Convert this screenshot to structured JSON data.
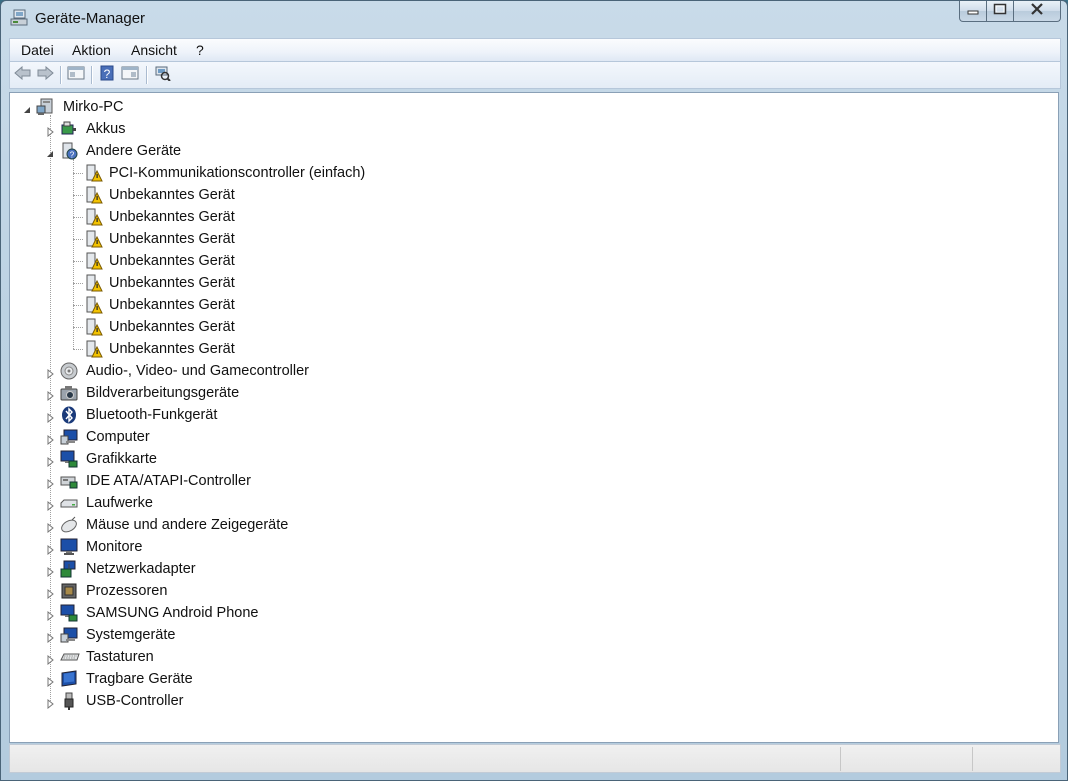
{
  "window": {
    "title": "Geräte-Manager"
  },
  "menu": {
    "items": [
      "Datei",
      "Aktion",
      "Ansicht",
      "?"
    ]
  },
  "toolbar": {
    "buttons": [
      "back-arrow-icon",
      "forward-arrow-icon",
      "properties-pane-icon",
      "help-icon",
      "view-icon",
      "scan-hardware-icon"
    ]
  },
  "tree": {
    "root": {
      "label": "Mirko-PC",
      "icon": "computer-icon",
      "expanded": true
    },
    "categories": [
      {
        "label": "Akkus",
        "icon": "battery-icon",
        "expanded": false
      },
      {
        "label": "Andere Geräte",
        "icon": "unknown-device-icon",
        "expanded": true,
        "children": [
          {
            "label": "PCI-Kommunikationscontroller (einfach)",
            "icon": "warning-device-icon"
          },
          {
            "label": "Unbekanntes Gerät",
            "icon": "warning-device-icon"
          },
          {
            "label": "Unbekanntes Gerät",
            "icon": "warning-device-icon"
          },
          {
            "label": "Unbekanntes Gerät",
            "icon": "warning-device-icon"
          },
          {
            "label": "Unbekanntes Gerät",
            "icon": "warning-device-icon"
          },
          {
            "label": "Unbekanntes Gerät",
            "icon": "warning-device-icon"
          },
          {
            "label": "Unbekanntes Gerät",
            "icon": "warning-device-icon"
          },
          {
            "label": "Unbekanntes Gerät",
            "icon": "warning-device-icon"
          },
          {
            "label": "Unbekanntes Gerät",
            "icon": "warning-device-icon"
          }
        ]
      },
      {
        "label": "Audio-, Video- und Gamecontroller",
        "icon": "speaker-icon",
        "expanded": false
      },
      {
        "label": "Bildverarbeitungsgeräte",
        "icon": "camera-icon",
        "expanded": false
      },
      {
        "label": "Bluetooth-Funkgerät",
        "icon": "bluetooth-icon",
        "expanded": false
      },
      {
        "label": "Computer",
        "icon": "computer-icon",
        "expanded": false
      },
      {
        "label": "Grafikkarte",
        "icon": "display-adapter-icon",
        "expanded": false
      },
      {
        "label": "IDE ATA/ATAPI-Controller",
        "icon": "ide-controller-icon",
        "expanded": false
      },
      {
        "label": "Laufwerke",
        "icon": "disk-drive-icon",
        "expanded": false
      },
      {
        "label": "Mäuse und andere Zeigegeräte",
        "icon": "mouse-icon",
        "expanded": false
      },
      {
        "label": "Monitore",
        "icon": "monitor-icon",
        "expanded": false
      },
      {
        "label": "Netzwerkadapter",
        "icon": "network-adapter-icon",
        "expanded": false
      },
      {
        "label": "Prozessoren",
        "icon": "processor-icon",
        "expanded": false
      },
      {
        "label": "SAMSUNG Android Phone",
        "icon": "phone-icon",
        "expanded": false
      },
      {
        "label": "Systemgeräte",
        "icon": "system-device-icon",
        "expanded": false
      },
      {
        "label": "Tastaturen",
        "icon": "keyboard-icon",
        "expanded": false
      },
      {
        "label": "Tragbare Geräte",
        "icon": "portable-device-icon",
        "expanded": false
      },
      {
        "label": "USB-Controller",
        "icon": "usb-icon",
        "expanded": false
      }
    ]
  },
  "colors": {
    "frame": "#bcd2e3",
    "content_bg": "#ffffff",
    "warning": "#f2c200"
  }
}
